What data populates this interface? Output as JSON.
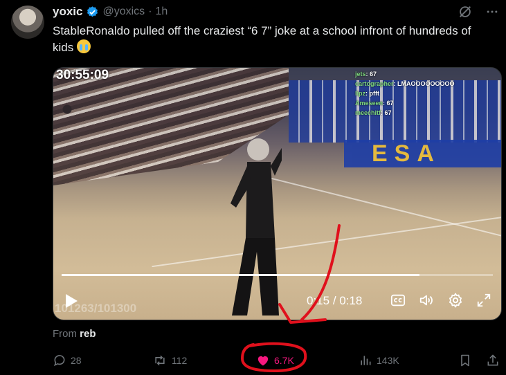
{
  "author": {
    "name": "yoxic",
    "handle": "@yoxics",
    "separator": "·",
    "time": "1h",
    "verified": true
  },
  "tweet": {
    "text": "StableRonaldo pulled off the craziest “6 7” joke at a school infront of hundreds of kids",
    "emoji": "loudly-crying-face"
  },
  "video": {
    "timestamp_overlay": "30:55:09",
    "chat": [
      {
        "user": "jets",
        "message": "67"
      },
      {
        "user": "cartographer",
        "message": "LMAOOOOOOOOO"
      },
      {
        "user": "lipz",
        "message": "pfft"
      },
      {
        "user": "Ameseen",
        "message": "67"
      },
      {
        "user": "meechitf",
        "message": "67"
      }
    ],
    "watermark": "101263/101300",
    "wall_text": "ESA",
    "current_time": "0:15",
    "duration": "0:18",
    "time_separator": "/",
    "progress": 0.83,
    "icons": [
      "play-icon",
      "captions-icon",
      "volume-icon",
      "settings-icon",
      "fullscreen-icon"
    ]
  },
  "source": {
    "prefix": "From",
    "name": "reb"
  },
  "actions": {
    "replies": "28",
    "reposts": "112",
    "likes": "6.7K",
    "views": "143K"
  },
  "colors": {
    "background": "#000000",
    "verified": "#1d9bf0",
    "like": "#f91880",
    "muted": "#71767b",
    "annotation": "#e0101c"
  }
}
